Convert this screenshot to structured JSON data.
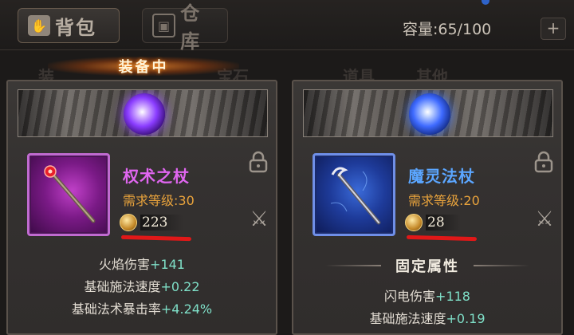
{
  "tabs": [
    {
      "label": "背包",
      "icon": "backpack-icon",
      "active": true
    },
    {
      "label": "仓库",
      "icon": "storage-icon",
      "active": false
    }
  ],
  "capacity": {
    "text": "容量:65/100",
    "plus_label": "+"
  },
  "equipped_label": "装备中",
  "background_tabs": [
    "装",
    "宝石",
    "道具",
    "其他"
  ],
  "colors": {
    "accent_orange": "#ff8a1a",
    "rarity_purple": "#e066f0",
    "rarity_blue": "#5ba6ff",
    "requirement": "#e9a33c",
    "bonus_green": "#7fe0c8",
    "annotation_red": "#e01818"
  },
  "panels": [
    {
      "name": "权术之杖",
      "rarity": "purple",
      "requirement": "需求等级:30",
      "score": "223",
      "stats": [
        {
          "label": "火焰伤害",
          "bonus": "+141"
        },
        {
          "label": "基础施法速度",
          "bonus": "+0.22"
        },
        {
          "label": "基础法术暴击率",
          "bonus": "+4.24%"
        }
      ]
    },
    {
      "name": "魔灵法杖",
      "rarity": "blue",
      "requirement": "需求等级:20",
      "score": "28",
      "section_title": "固定属性",
      "stats": [
        {
          "label": "闪电伤害",
          "bonus": "+118"
        },
        {
          "label": "基础施法速度",
          "bonus": "+0.19"
        }
      ]
    }
  ]
}
